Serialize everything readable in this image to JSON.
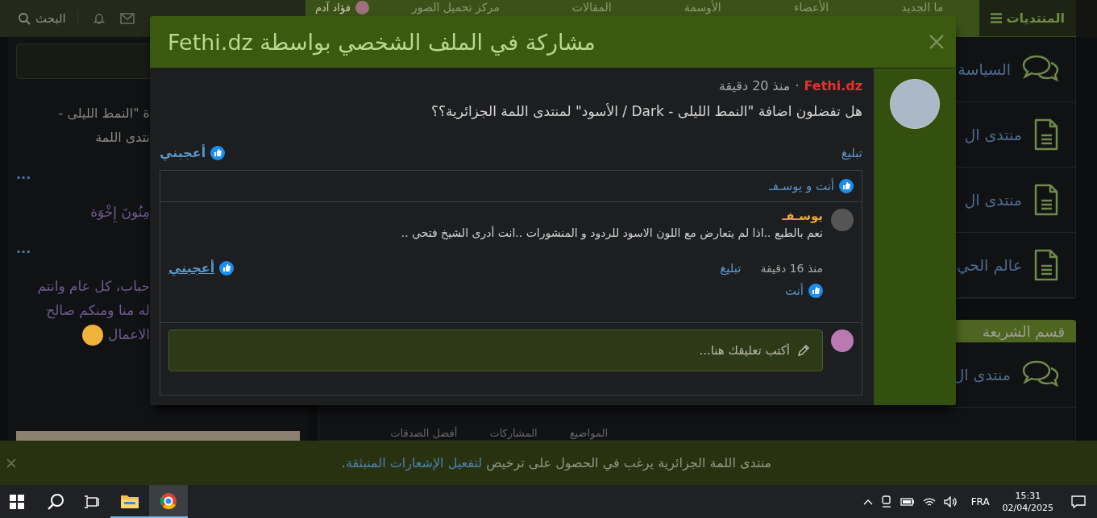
{
  "topbar": {
    "forums_label": "المنتديات",
    "nav_items": [
      "ما الجديد",
      "الأعضاء",
      "الأوسمة",
      "المقالات",
      "مركز تحميل الصور"
    ],
    "user_name": "فؤاد آدم",
    "search_label": "البحث"
  },
  "sidebar": {
    "snippets": [
      {
        "kind": "text",
        "lines": [
          "ة \"النمط الليلى -",
          "نتدى اللمة"
        ]
      },
      {
        "kind": "more",
        "lines": [
          "..."
        ]
      },
      {
        "kind": "quote",
        "lines": [
          "مِنُونَ إِخْوَة"
        ]
      },
      {
        "kind": "more",
        "lines": [
          "..."
        ]
      },
      {
        "kind": "quote",
        "lines": [
          "حباب، كل عام وانتم",
          "له منا ومنكم صالح",
          "الاعمال"
        ]
      }
    ]
  },
  "forums": {
    "items": [
      {
        "kind": "chat",
        "title": "السياسة"
      },
      {
        "kind": "doc",
        "title": "منتدى ال"
      },
      {
        "kind": "doc",
        "title": "منتدى ال"
      },
      {
        "kind": "doc",
        "title": "عالم الحي"
      }
    ],
    "section_title": "قسم الشريعة",
    "section_items": [
      {
        "kind": "chat",
        "title": "منتدى ال"
      }
    ],
    "footer_labels": [
      "المواضيع",
      "المشاركات",
      "أفضل الصدقات"
    ]
  },
  "modal": {
    "title": "مشاركة في الملف الشخصي بواسطة Fethi.dz",
    "post": {
      "author": "Fethi.dz",
      "separator": "·",
      "time": "منذ 20 دقيقة",
      "message": "هل تفضلون اضافة \"النمط الليلى - Dark / الأسود\" لمنتدى اللمة الجزائرية؟؟",
      "report": "تبليغ",
      "like": "أعجبني",
      "likers": "أنت و يوسـفـ"
    },
    "comments": [
      {
        "author": "يوسـفـ",
        "message": "نعم بالطبع ..اذا لم يتعارض مع اللون الاسود للردود و المنشورات ..انت أدرى الشيخ فتحي ..",
        "time": "منذ 16 دقيقة",
        "report": "تبليغ",
        "like": "أعجبني",
        "likers": "أنت"
      }
    ],
    "comment_placeholder": "أكتب تعليقك هنا..."
  },
  "notification": {
    "text": "منتدى اللمة الجزائرية يرغب في الحصول على ترخيص ",
    "link": "لتفعيل الإشعارات المنبثقة",
    "suffix": "."
  },
  "taskbar": {
    "language": "FRA",
    "time": "15:31",
    "date": "02/04/2025"
  }
}
